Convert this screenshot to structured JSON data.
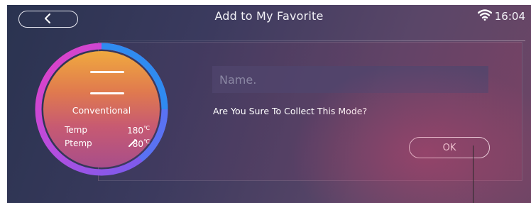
{
  "header": {
    "back_icon": "chevron-left-icon",
    "title": "Add to My Favorite",
    "wifi_icon": "wifi-icon",
    "time": "16:04"
  },
  "mode_card": {
    "menu_icon": "heating-element-icon",
    "name": "Conventional",
    "temp_label": "Temp",
    "temp_value": "180",
    "temp_unit": "℃",
    "ptemp_label": "Ptemp",
    "probe_icon": "probe-icon",
    "ptemp_value": "80",
    "ptemp_unit": "℃"
  },
  "form": {
    "name_placeholder": "Name.",
    "name_value": "",
    "question": "Are You Sure To Collect This Mode?",
    "ok_label": "OK"
  },
  "colors": {
    "ring_pink": "#e040c8",
    "ring_blue": "#2f8bf0",
    "ring_purple": "#9a52e8",
    "inner_orange": "#f0a93f",
    "inner_purple": "#a84e8a"
  }
}
